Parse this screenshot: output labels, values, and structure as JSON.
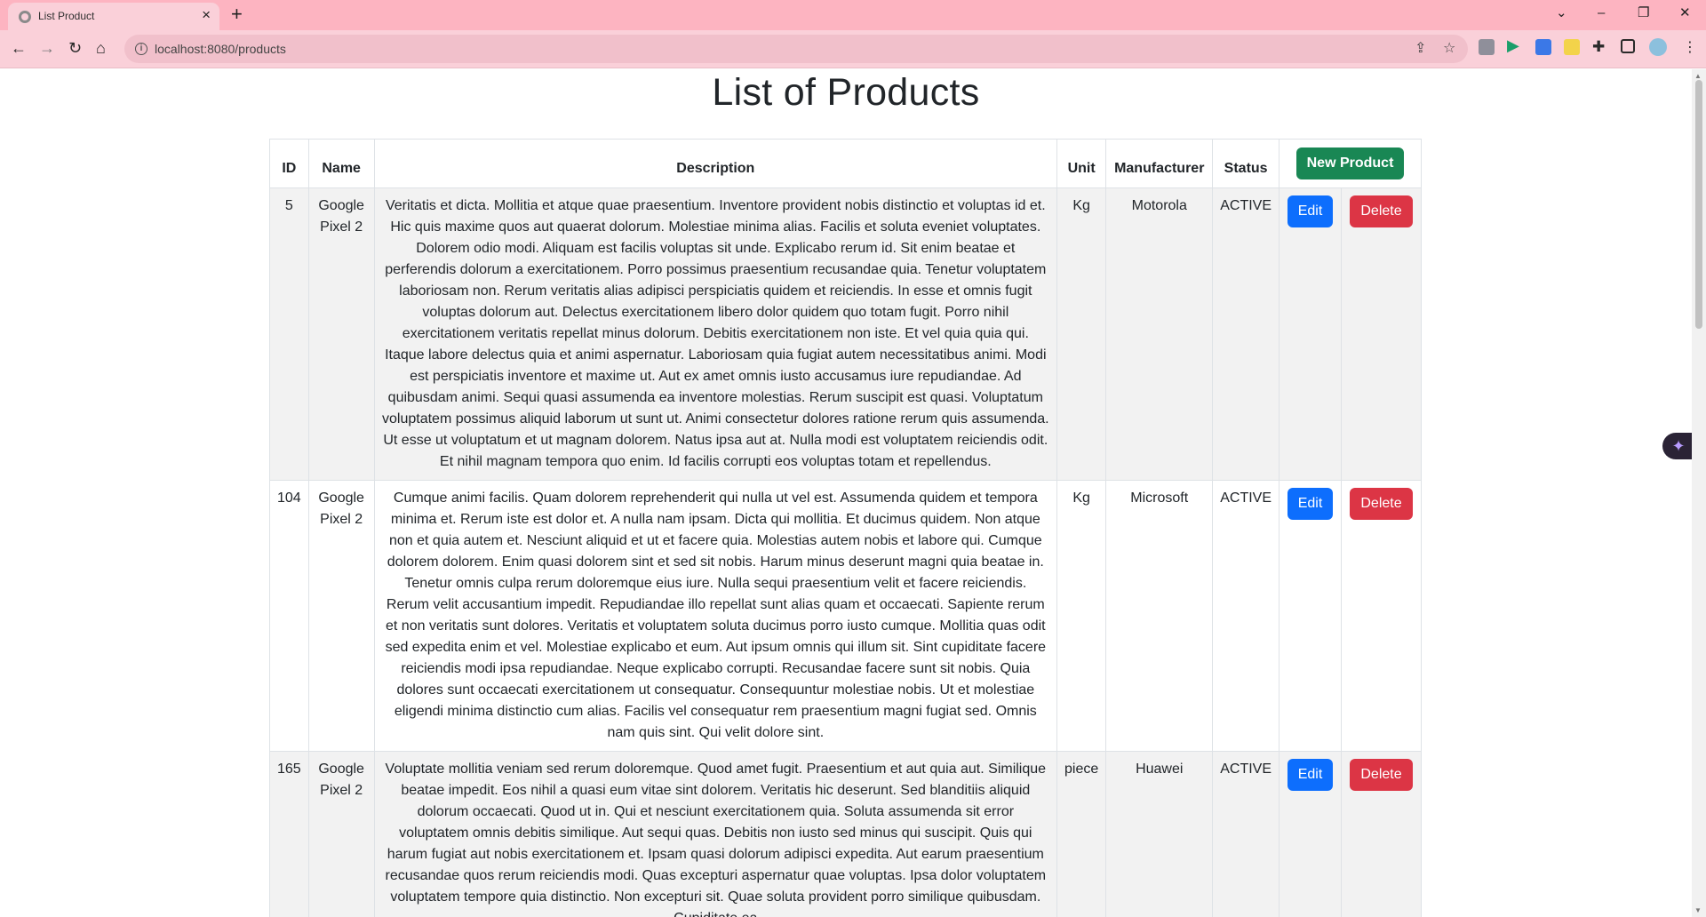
{
  "browser": {
    "tab_title": "List Product",
    "url": "localhost:8080/products"
  },
  "page": {
    "title": "List of Products",
    "new_product_label": "New Product",
    "edit_label": "Edit",
    "delete_label": "Delete"
  },
  "table": {
    "headers": {
      "id": "ID",
      "name": "Name",
      "description": "Description",
      "unit": "Unit",
      "manufacturer": "Manufacturer",
      "status": "Status"
    },
    "rows": [
      {
        "id": "5",
        "name": "Google Pixel 2",
        "description": "Veritatis et dicta. Mollitia et atque quae praesentium. Inventore provident nobis distinctio et voluptas id et. Hic quis maxime quos aut quaerat dolorum. Molestiae minima alias. Facilis et soluta eveniet voluptates. Dolorem odio modi. Aliquam est facilis voluptas sit unde. Explicabo rerum id. Sit enim beatae et perferendis dolorum a exercitationem. Porro possimus praesentium recusandae quia. Tenetur voluptatem laboriosam non. Rerum veritatis alias adipisci perspiciatis quidem et reiciendis. In esse et omnis fugit voluptas dolorum aut. Delectus exercitationem libero dolor quidem quo totam fugit. Porro nihil exercitationem veritatis repellat minus dolorum. Debitis exercitationem non iste. Et vel quia quia qui. Itaque labore delectus quia et animi aspernatur. Laboriosam quia fugiat autem necessitatibus animi. Modi est perspiciatis inventore et maxime ut. Aut ex amet omnis iusto accusamus iure repudiandae. Ad quibusdam animi. Sequi quasi assumenda ea inventore molestias. Rerum suscipit est quasi. Voluptatum voluptatem possimus aliquid laborum ut sunt ut. Animi consectetur dolores ratione rerum quis assumenda. Ut esse ut voluptatum et ut magnam dolorem. Natus ipsa aut at. Nulla modi est voluptatem reiciendis odit. Et nihil magnam tempora quo enim. Id facilis corrupti eos voluptas totam et repellendus.",
        "unit": "Kg",
        "manufacturer": "Motorola",
        "status": "ACTIVE"
      },
      {
        "id": "104",
        "name": "Google Pixel 2",
        "description": "Cumque animi facilis. Quam dolorem reprehenderit qui nulla ut vel est. Assumenda quidem et tempora minima et. Rerum iste est dolor et. A nulla nam ipsam. Dicta qui mollitia. Et ducimus quidem. Non atque non et quia autem et. Nesciunt aliquid et ut et facere quia. Molestias autem nobis et labore qui. Cumque dolorem dolorem. Enim quasi dolorem sint et sed sit nobis. Harum minus deserunt magni quia beatae in. Tenetur omnis culpa rerum doloremque eius iure. Nulla sequi praesentium velit et facere reiciendis. Rerum velit accusantium impedit. Repudiandae illo repellat sunt alias quam et occaecati. Sapiente rerum et non veritatis sunt dolores. Veritatis et voluptatem soluta ducimus porro iusto cumque. Mollitia quas odit sed expedita enim et vel. Molestiae explicabo et eum. Aut ipsum omnis qui illum sit. Sint cupiditate facere reiciendis modi ipsa repudiandae. Neque explicabo corrupti. Recusandae facere sunt sit nobis. Quia dolores sunt occaecati exercitationem ut consequatur. Consequuntur molestiae nobis. Ut et molestiae eligendi minima distinctio cum alias. Facilis vel consequatur rem praesentium magni fugiat sed. Omnis nam quis sint. Qui velit dolore sint.",
        "unit": "Kg",
        "manufacturer": "Microsoft",
        "status": "ACTIVE"
      },
      {
        "id": "165",
        "name": "Google Pixel 2",
        "description": "Voluptate mollitia veniam sed rerum doloremque. Quod amet fugit. Praesentium et aut quia aut. Similique beatae impedit. Eos nihil a quasi eum vitae sint dolorem. Veritatis hic deserunt. Sed blanditiis aliquid dolorum occaecati. Quod ut in. Qui et nesciunt exercitationem quia. Soluta assumenda sit error voluptatem omnis debitis similique. Aut sequi quas. Debitis non iusto sed minus qui suscipit. Quis qui harum fugiat aut nobis exercitationem et. Ipsam quasi dolorum adipisci expedita. Aut earum praesentium recusandae quos rerum reiciendis modi. Quas excepturi aspernatur quae voluptas. Ipsa dolor voluptatem voluptatem tempore quia distinctio. Non excepturi sit. Quae soluta provident porro similique quibusdam. Cupiditate ea",
        "unit": "piece",
        "manufacturer": "Huawei",
        "status": "ACTIVE"
      }
    ]
  }
}
